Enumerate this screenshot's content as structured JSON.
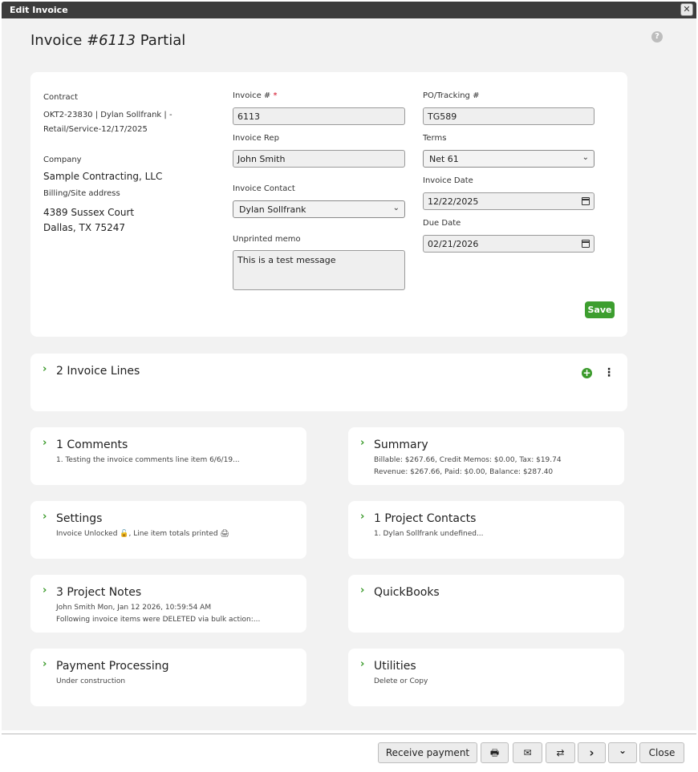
{
  "window": {
    "title": "Edit Invoice",
    "close_glyph": "✕"
  },
  "header": {
    "prefix": "Invoice ",
    "number": "#6113",
    "status": " Partial",
    "help_glyph": "?"
  },
  "form": {
    "contract_label": "Contract",
    "contract_line1": "OKT2-23830 | Dylan Sollfrank | -",
    "contract_line2": "Retail/Service-12/17/2025",
    "company_label": "Company",
    "company_value": "Sample Contracting, LLC",
    "address_label": "Billing/Site address",
    "address_line1": "4389 Sussex Court",
    "address_line2": "Dallas, TX 75247",
    "invoice_num_label": "Invoice # ",
    "required_mark": "*",
    "invoice_num_value": "6113",
    "invoice_rep_label": "Invoice Rep",
    "invoice_rep_value": "John Smith",
    "invoice_contact_label": "Invoice Contact",
    "invoice_contact_value": "Dylan Sollfrank",
    "memo_label": "Unprinted memo",
    "memo_value": "This is a test message",
    "po_label": "PO/Tracking #",
    "po_value": "TG589",
    "terms_label": "Terms",
    "terms_value": "Net 61",
    "invoice_date_label": "Invoice Date",
    "invoice_date_value": "12/22/2025",
    "due_date_label": "Due Date",
    "due_date_value": "02/21/2026",
    "save_label": "Save"
  },
  "sections": {
    "invoice_lines": {
      "title": "2 Invoice Lines"
    },
    "comments": {
      "title": "1 Comments",
      "line1": "1. Testing the invoice comments line item 6/6/19..."
    },
    "summary": {
      "title": "Summary",
      "line1": "Billable: $267.66, Credit Memos: $0.00, Tax: $19.74",
      "line2": "Revenue: $267.66, Paid: $0.00, Balance: $287.40"
    },
    "settings": {
      "title": "Settings",
      "line1": "Invoice Unlocked 🔓, Line item totals printed 🖨"
    },
    "project_contacts": {
      "title": "1 Project Contacts",
      "line1": "1. Dylan Sollfrank undefined..."
    },
    "project_notes": {
      "title": "3 Project Notes",
      "line1": "John Smith  Mon, Jan 12 2026, 10:59:54 AM",
      "line2": "Following invoice items were DELETED via bulk action:..."
    },
    "quickbooks": {
      "title": "QuickBooks"
    },
    "payment_processing": {
      "title": "Payment Processing",
      "line1": "Under construction"
    },
    "utilities": {
      "title": "Utilities",
      "line1": "Delete or Copy"
    }
  },
  "footer": {
    "receive_payment_label": "Receive payment",
    "print_glyph": "🖶",
    "email_glyph": "✉",
    "transfer_glyph": "⇄",
    "next_glyph": "›",
    "more_glyph": "⌄",
    "close_label": "Close"
  },
  "icons": {
    "chevron_right": "›",
    "chevron_down": "⌄",
    "plus": "+",
    "kebab": "⋮"
  }
}
